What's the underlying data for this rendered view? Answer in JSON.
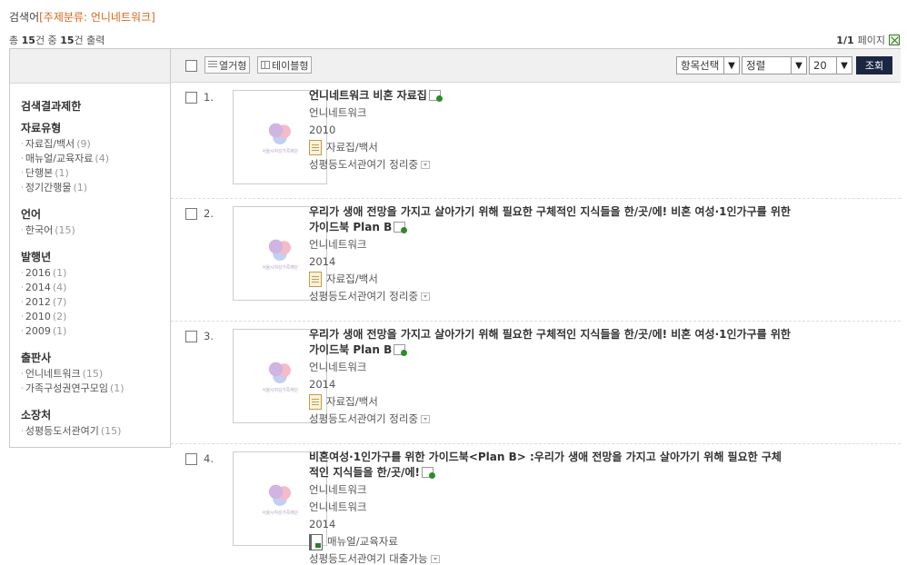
{
  "search": {
    "label": "검색어",
    "tag": "[주제분류: 언니네트워크]"
  },
  "summary": {
    "prefix": "총",
    "total": "15",
    "mid": "건 중",
    "shown": "15",
    "suffix": "건 출력"
  },
  "pager": {
    "current": "1/1",
    "label": "페이지"
  },
  "toolbar": {
    "list_view": "열거형",
    "table_view": "테이블형",
    "field_select": "항목선택",
    "sort_select": "정렬",
    "page_size": "20",
    "search_button": "조회"
  },
  "sidebar": {
    "heading": "검색결과제한",
    "groups": [
      {
        "title": "자료유형",
        "items": [
          {
            "label": "자료집/백서",
            "count": "(9)"
          },
          {
            "label": "매뉴얼/교육자료",
            "count": "(4)"
          },
          {
            "label": "단행본",
            "count": "(1)"
          },
          {
            "label": "정기간행물",
            "count": "(1)"
          }
        ]
      },
      {
        "title": "언어",
        "items": [
          {
            "label": "한국어",
            "count": "(15)"
          }
        ]
      },
      {
        "title": "발행년",
        "items": [
          {
            "label": "2016",
            "count": "(1)"
          },
          {
            "label": "2014",
            "count": "(4)"
          },
          {
            "label": "2012",
            "count": "(7)"
          },
          {
            "label": "2010",
            "count": "(2)"
          },
          {
            "label": "2009",
            "count": "(1)"
          }
        ]
      },
      {
        "title": "출판사",
        "items": [
          {
            "label": "언니네트워크",
            "count": "(15)"
          },
          {
            "label": "가족구성권연구모임",
            "count": "(1)"
          }
        ]
      },
      {
        "title": "소장처",
        "items": [
          {
            "label": "성평등도서관여기",
            "count": "(15)"
          }
        ]
      }
    ]
  },
  "thumbnail_text": "서울시여성가족재단",
  "results": [
    {
      "num": "1.",
      "title": "언니네트워크 비혼 자료집",
      "lines": [
        "언니네트워크"
      ],
      "year": "2010",
      "type": "자료집/백서",
      "type_icon": "document-icon",
      "location": "성평등도서관여기 정리중"
    },
    {
      "num": "2.",
      "title": "우리가 생애 전망을 가지고 살아가기 위해 필요한 구체적인 지식들을 한/곳/에! 비혼 여성·1인가구를 위한 가이드북 Plan B",
      "lines": [
        "언니네트워크"
      ],
      "year": "2014",
      "type": "자료집/백서",
      "type_icon": "document-icon",
      "location": "성평등도서관여기 정리중"
    },
    {
      "num": "3.",
      "title": "우리가 생애 전망을 가지고 살아가기 위해 필요한 구체적인 지식들을 한/곳/에! 비혼 여성·1인가구를 위한 가이드북 Plan B",
      "lines": [
        "언니네트워크"
      ],
      "year": "2014",
      "type": "자료집/백서",
      "type_icon": "document-icon",
      "location": "성평등도서관여기 정리중"
    },
    {
      "num": "4.",
      "title": "비혼여성·1인가구를 위한 가이드북<Plan B> :우리가 생애 전망을 가지고 살아가기 위해 필요한 구체적인 지식들을 한/곳/에!",
      "lines": [
        "언니네트워크",
        "언니네트워크"
      ],
      "year": "2014",
      "type": "매뉴얼/교육자료",
      "type_icon": "manual-icon",
      "location": "성평등도서관여기 대출가능"
    }
  ]
}
